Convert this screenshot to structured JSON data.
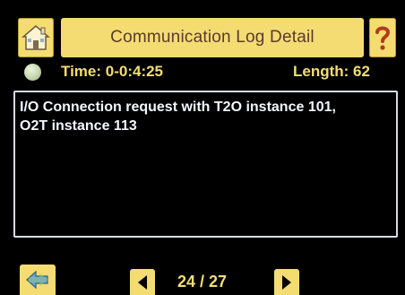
{
  "header": {
    "title": "Communication Log Detail",
    "home_icon": "home-icon",
    "help_icon": "help-question-icon"
  },
  "status": {
    "indicator": "status-led-icon",
    "indicator_color": "#c4d7ae",
    "time": "Time: 0-0:4:25",
    "length": "Length: 62"
  },
  "message": {
    "text": "I/O Connection request with T2O instance 101,\nO2T instance 113"
  },
  "footer": {
    "back_icon": "back-arrow-icon",
    "prev_icon": "chevron-left-icon",
    "next_icon": "chevron-right-icon",
    "page": "24 / 27"
  },
  "colors": {
    "accent": "#f4dc73",
    "text_yellow": "#f3de74",
    "background": "#000000",
    "title_text": "#5b3a2d"
  }
}
